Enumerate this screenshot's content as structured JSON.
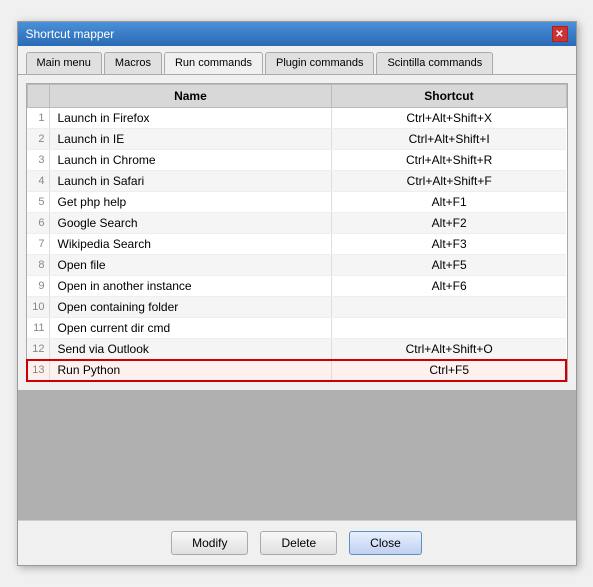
{
  "window": {
    "title": "Shortcut mapper",
    "close_label": "✕"
  },
  "tabs": [
    {
      "id": "main-menu",
      "label": "Main menu",
      "active": false
    },
    {
      "id": "macros",
      "label": "Macros",
      "active": false
    },
    {
      "id": "run-commands",
      "label": "Run commands",
      "active": true
    },
    {
      "id": "plugin-commands",
      "label": "Plugin commands",
      "active": false
    },
    {
      "id": "scintilla-commands",
      "label": "Scintilla commands",
      "active": false
    }
  ],
  "table": {
    "headers": [
      "Name",
      "Shortcut"
    ],
    "rows": [
      {
        "num": "1",
        "name": "Launch in Firefox",
        "shortcut": "Ctrl+Alt+Shift+X",
        "selected": false
      },
      {
        "num": "2",
        "name": "Launch in IE",
        "shortcut": "Ctrl+Alt+Shift+I",
        "selected": false
      },
      {
        "num": "3",
        "name": "Launch in Chrome",
        "shortcut": "Ctrl+Alt+Shift+R",
        "selected": false
      },
      {
        "num": "4",
        "name": "Launch in Safari",
        "shortcut": "Ctrl+Alt+Shift+F",
        "selected": false
      },
      {
        "num": "5",
        "name": "Get php help",
        "shortcut": "Alt+F1",
        "selected": false
      },
      {
        "num": "6",
        "name": "Google Search",
        "shortcut": "Alt+F2",
        "selected": false
      },
      {
        "num": "7",
        "name": "Wikipedia Search",
        "shortcut": "Alt+F3",
        "selected": false
      },
      {
        "num": "8",
        "name": "Open file",
        "shortcut": "Alt+F5",
        "selected": false
      },
      {
        "num": "9",
        "name": "Open in another instance",
        "shortcut": "Alt+F6",
        "selected": false
      },
      {
        "num": "10",
        "name": "Open containing folder",
        "shortcut": "",
        "selected": false
      },
      {
        "num": "11",
        "name": "Open current dir cmd",
        "shortcut": "",
        "selected": false
      },
      {
        "num": "12",
        "name": "Send via Outlook",
        "shortcut": "Ctrl+Alt+Shift+O",
        "selected": false
      },
      {
        "num": "13",
        "name": "Run Python",
        "shortcut": "Ctrl+F5",
        "selected": true
      }
    ]
  },
  "footer": {
    "modify_label": "Modify",
    "delete_label": "Delete",
    "close_label": "Close"
  }
}
